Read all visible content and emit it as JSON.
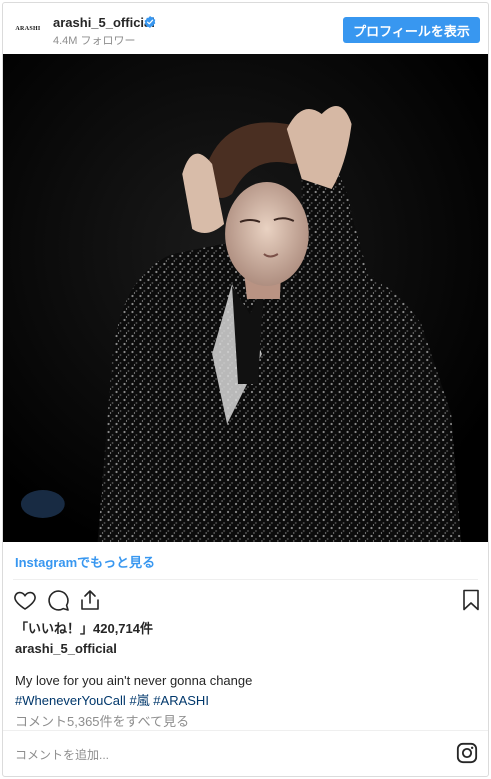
{
  "header": {
    "avatar_text": "ARASHI",
    "username": "arashi_5_official",
    "followers": "4.4M フォロワー",
    "profile_button": "プロフィールを表示"
  },
  "post": {
    "more_link": "Instagramでもっと見る",
    "likes": "「いいね！」420,714件",
    "caption_user": "arashi_5_official",
    "caption_text": "My love for you ain't never gonna change",
    "hashtags": [
      "#WheneverYouCall",
      "#嵐",
      "#ARASHI"
    ],
    "view_comments": "コメント5,365件をすべて見る",
    "comment_placeholder": "コメントを追加..."
  },
  "colors": {
    "accent": "#3897f0",
    "hashtag": "#00376b",
    "muted": "#8e8e8e"
  },
  "icons": [
    "verified-badge-icon",
    "heart-icon",
    "comment-icon",
    "share-icon",
    "bookmark-icon",
    "instagram-logo-icon"
  ]
}
